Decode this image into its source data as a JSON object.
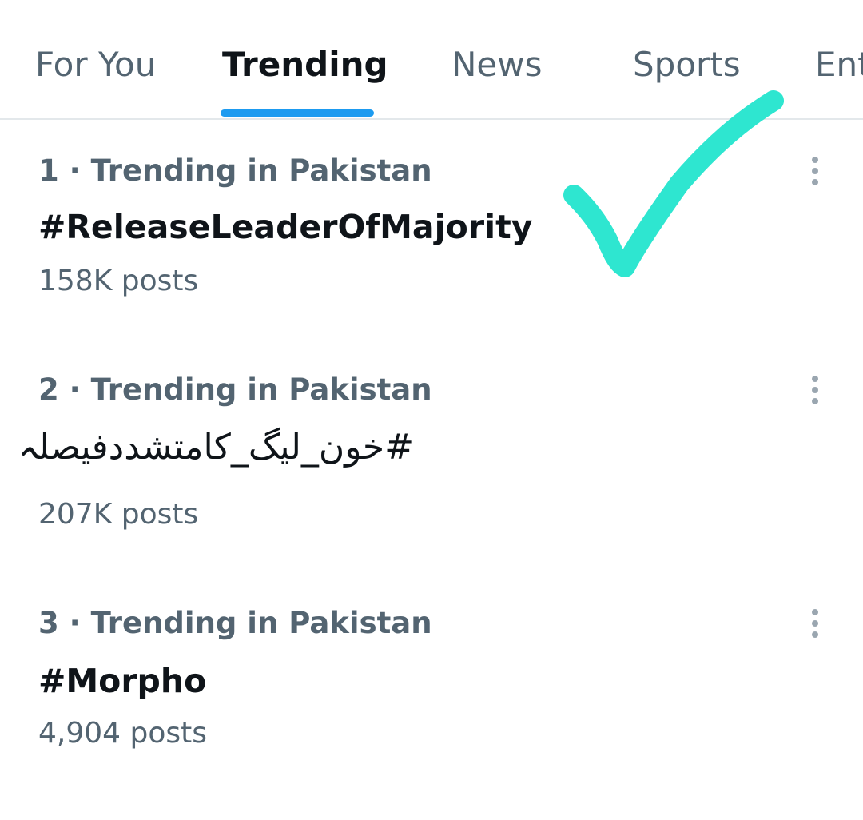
{
  "colors": {
    "accent": "#1d9bf0",
    "text_primary": "#0f1419",
    "text_secondary": "#536471",
    "divider": "#e3e8eb",
    "annotation": "#2ee6d0"
  },
  "tabs": [
    {
      "label": "For You",
      "active": false
    },
    {
      "label": "Trending",
      "active": true
    },
    {
      "label": "News",
      "active": false
    },
    {
      "label": "Sports",
      "active": false
    },
    {
      "label": "Ent",
      "active": false
    }
  ],
  "trends": [
    {
      "context": "1 · Trending in Pakistan",
      "name": "#ReleaseLeaderOfMajority",
      "posts": "158K posts",
      "more_icon": "more-vertical-icon"
    },
    {
      "context": "2 · Trending in Pakistan",
      "name": "#خون_لیگ_کامتشددفیصلہ",
      "posts": "207K posts",
      "more_icon": "more-vertical-icon"
    },
    {
      "context": "3 · Trending in Pakistan",
      "name": "#Morpho",
      "posts": "4,904 posts",
      "more_icon": "more-vertical-icon"
    }
  ],
  "annotation": {
    "icon": "checkmark-icon"
  }
}
